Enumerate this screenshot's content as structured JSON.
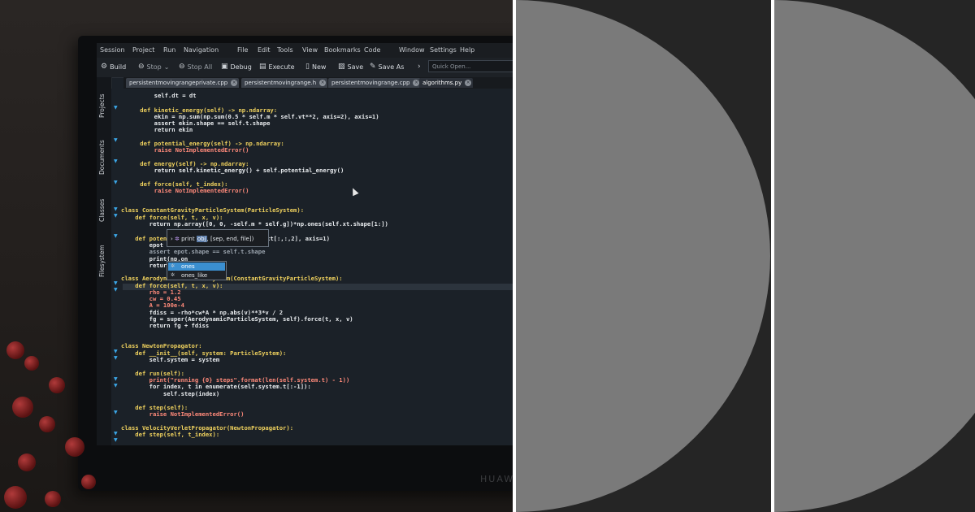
{
  "menu": [
    "Session",
    "Project",
    "Run",
    "Navigation",
    "File",
    "Edit",
    "Tools",
    "View",
    "Bookmarks",
    "Code",
    "Window",
    "Settings",
    "Help"
  ],
  "toolbar": {
    "build": "Build",
    "stop": "Stop",
    "stop_all": "Stop All",
    "debug": "Debug",
    "execute": "Execute",
    "new": "New",
    "save": "Save",
    "save_as": "Save As",
    "quick_open_placeholder": "Quick Open..."
  },
  "tabs": [
    {
      "label": "persistentmovingrangeprivate.cpp",
      "active": false
    },
    {
      "label": "persistentmovingrange.h",
      "active": false
    },
    {
      "label": "persistentmovingrange.cpp",
      "active": false
    },
    {
      "label": "algorithms.py",
      "active": true
    }
  ],
  "sidebar": [
    "Projects",
    "Documents",
    "Classes",
    "Filesystem"
  ],
  "calltip": {
    "name": "print",
    "arg": "obj",
    "rest": ", [sep, end, file])"
  },
  "completion": [
    "ones",
    "ones_like"
  ],
  "monitor_brand": "HUAWEI",
  "code_lines": [
    "        self.dt = dt",
    "    def kinetic_energy(self) -> np.ndarray:",
    "        ekin = np.sum(np.sum(0.5 * self.m * self.vt**2, axis=2), axis=1)",
    "        assert ekin.shape == self.t.shape",
    "        return ekin",
    "    def potential_energy(self) -> np.ndarray:",
    "        raise NotImplementedError()",
    "    def energy(self) -> np.ndarray:",
    "        return self.kinetic_energy() + self.potential_energy()",
    "    def force(self, t_index):",
    "        raise NotImplementedError()",
    "class ConstantGravityParticleSystem(ParticleSystem):",
    "    def force(self, t, x, v):",
    "        return np.array([0, 0, -self.m * self.g])*np.ones(self.xt.shape[1:])",
    "    def poten",
    "        epot",
    "xt[:,:,2], axis=1)",
    "        assert epot.shape == self.t.shape",
    "        print(np.on",
    "        retur",
    "class AerodynamicParticleSystem(ConstantGravityParticleSystem):",
    "    def force(self, t, x, v):",
    "        rho = 1.2",
    "        cw = 0.45",
    "        A = 100e-4",
    "        fdiss = -rho*cw*A * np.abs(v)**3*v / 2",
    "        fg = super(AerodynamicParticleSystem, self).force(t, x, v)",
    "        return fg + fdiss",
    "class NewtonPropagator:",
    "    def __init__(self, system: ParticleSystem):",
    "        self.system = system",
    "    def run(self):",
    "        print(\"running {0} steps\".format(len(self.system.t) - 1))",
    "        for index, t in enumerate(self.system.t[:-1]):",
    "            self.step(index)",
    "    def step(self):",
    "        raise NotImplementedError()",
    "class VelocityVerletPropagator(NewtonPropagator):",
    "    def step(self, t_index):"
  ]
}
